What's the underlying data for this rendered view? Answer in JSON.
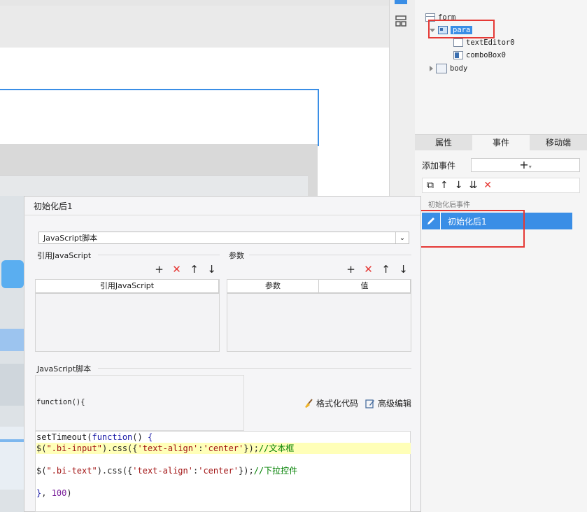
{
  "structure_tree": {
    "items": [
      {
        "label": "form"
      },
      {
        "label": "para"
      },
      {
        "label": "textEditor0"
      },
      {
        "label": "comboBox0"
      },
      {
        "label": "body"
      }
    ]
  },
  "tabs": [
    "属性",
    "事件",
    "移动端"
  ],
  "events_panel": {
    "add_event_label": "添加事件",
    "add_event_button": "+",
    "group_label": "初始化后事件",
    "selected_event": "初始化后1"
  },
  "dialog": {
    "title": "初始化后1",
    "script_type": "JavaScript脚本",
    "ref_js_section": "引用JavaScript",
    "params_section": "参数",
    "ref_js_column": "引用JavaScript",
    "params_columns": [
      "参数",
      "值"
    ],
    "script_section": "JavaScript脚本",
    "function_header": "function(){",
    "format_code_label": "格式化代码",
    "advanced_edit_label": "高级编辑",
    "code_lines": [
      "setTimeout(function() {",
      "$(\".bi-input\").css({'text-align':'center'});//文本框",
      "",
      "$(\".bi-text\").css({'text-align':'center'});//下拉控件",
      "",
      "}, 100)"
    ]
  },
  "colors": {
    "accent": "#3a8ee6",
    "highlight_frame": "#e53935",
    "code_keyword": "#1a1aa6",
    "code_string": "#a31515",
    "code_comment": "#008000"
  }
}
